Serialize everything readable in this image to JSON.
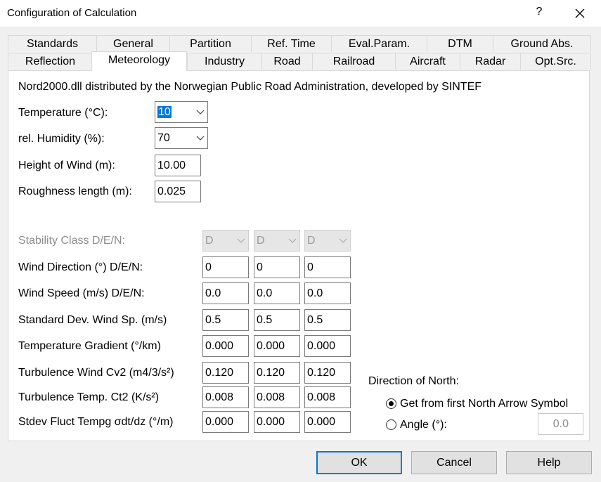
{
  "window": {
    "title": "Configuration of Calculation",
    "help_glyph": "?",
    "close_icon": "close-icon"
  },
  "tabs_row1": [
    "Standards",
    "General",
    "Partition",
    "Ref. Time",
    "Eval.Param.",
    "DTM",
    "Ground Abs."
  ],
  "tabs_row2": [
    "Reflection",
    "Meteorology",
    "Industry",
    "Road",
    "Railroad",
    "Aircraft",
    "Radar",
    "Opt.Src."
  ],
  "active_tab": "Meteorology",
  "info_text": "Nord2000.dll distributed by the Norwegian Public Road Administration, developed by SINTEF",
  "temperature": {
    "label": "Temperature (°C):",
    "value": "10"
  },
  "humidity": {
    "label": "rel. Humidity (%):",
    "value": "70"
  },
  "wind_height": {
    "label": "Height of Wind (m):",
    "value": "10.00"
  },
  "roughness": {
    "label": "Roughness length (m):",
    "value": "0.025"
  },
  "stability": {
    "label": "Stability Class D/E/N:",
    "values": [
      "D",
      "D",
      "D"
    ]
  },
  "grid_rows": [
    {
      "label": "Wind Direction (°) D/E/N:",
      "values": [
        "0",
        "0",
        "0"
      ]
    },
    {
      "label": "Wind Speed (m/s) D/E/N:",
      "values": [
        "0.0",
        "0.0",
        "0.0"
      ]
    },
    {
      "label": "Standard Dev. Wind Sp. (m/s)",
      "values": [
        "0.5",
        "0.5",
        "0.5"
      ]
    },
    {
      "label": "Temperature Gradient (°/km)",
      "values": [
        "0.000",
        "0.000",
        "0.000"
      ]
    },
    {
      "label": "Turbulence Wind Cv2 (m4/3/s²)",
      "values": [
        "0.120",
        "0.120",
        "0.120"
      ]
    },
    {
      "label": "Turbulence Temp. Ct2 (K/s²)",
      "values": [
        "0.008",
        "0.008",
        "0.008"
      ]
    },
    {
      "label": "Stdev Fluct Tempg σdt/dz (°/m)",
      "values": [
        "0.000",
        "0.000",
        "0.000"
      ]
    }
  ],
  "north": {
    "heading": "Direction of North:",
    "option1": "Get from first North Arrow Symbol",
    "option2": "Angle (°):",
    "selected": "option1",
    "angle_value": "0.0"
  },
  "buttons": {
    "ok": "OK",
    "cancel": "Cancel",
    "help": "Help"
  },
  "colors": {
    "accent": "#0078d7",
    "window_bg": "#f0f0f0",
    "panel_bg": "#ffffff",
    "disabled_text": "#8d8d8d"
  }
}
